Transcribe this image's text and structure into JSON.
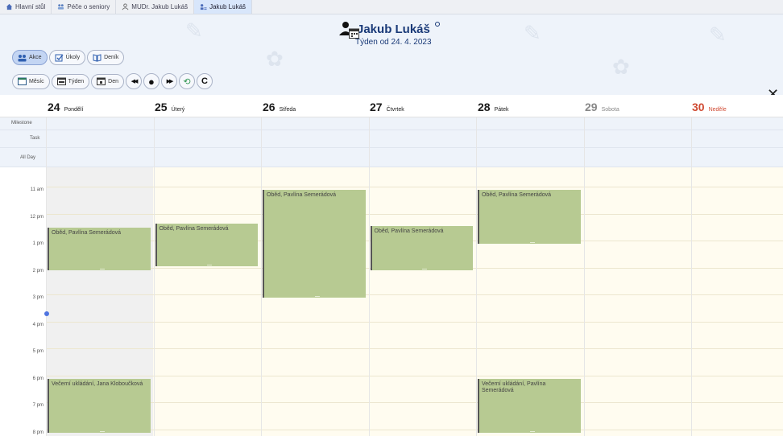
{
  "tabs": [
    {
      "label": "Hlavní stůl",
      "icon": "home-icon",
      "active": false
    },
    {
      "label": "Péče o seniory",
      "icon": "people-icon",
      "active": false
    },
    {
      "label": "MUDr. Jakub Lukáš",
      "icon": "person-icon",
      "active": false
    },
    {
      "label": "Jakub Lukáš",
      "icon": "user-list-icon",
      "active": true
    }
  ],
  "header": {
    "title": "Jakub Lukáš",
    "subtitle": "Týden od 24. 4. 2023"
  },
  "view_buttons": [
    {
      "label": "Akce",
      "icon": "people-icon",
      "active": true
    },
    {
      "label": "Úkoly",
      "icon": "checkbox-icon",
      "active": false
    },
    {
      "label": "Deník",
      "icon": "book-icon",
      "active": false
    }
  ],
  "range_buttons": [
    {
      "label": "Měsíc",
      "icon": "calendar-month-icon"
    },
    {
      "label": "Týden",
      "icon": "calendar-week-icon"
    },
    {
      "label": "Den",
      "icon": "calendar-day-icon"
    }
  ],
  "nav_buttons": [
    {
      "name": "prev-button",
      "glyph": "◀◀"
    },
    {
      "name": "today-button",
      "glyph": "●"
    },
    {
      "name": "next-button",
      "glyph": "▶▶"
    },
    {
      "name": "sync-button",
      "glyph": "⟲"
    },
    {
      "name": "refresh-button",
      "glyph": "C"
    }
  ],
  "close_glyph": "✕",
  "days": [
    {
      "num": "24",
      "name": "Pondělí",
      "color": "#1a1a1a"
    },
    {
      "num": "25",
      "name": "Úterý",
      "color": "#1a1a1a"
    },
    {
      "num": "26",
      "name": "Středa",
      "color": "#1a1a1a"
    },
    {
      "num": "27",
      "name": "Čtvrtek",
      "color": "#1a1a1a"
    },
    {
      "num": "28",
      "name": "Pátek",
      "color": "#1a1a1a"
    },
    {
      "num": "29",
      "name": "Sobota",
      "color": "#888888"
    },
    {
      "num": "30",
      "name": "Neděle",
      "color": "#d04a32"
    }
  ],
  "sections": [
    "Milestone",
    "Task",
    "All Day"
  ],
  "hours": [
    "11 am",
    "12 pm",
    "1 pm",
    "2 pm",
    "3 pm",
    "4 pm",
    "5 pm",
    "6 pm",
    "7 pm",
    "8 pm"
  ],
  "events": [
    {
      "day": 0,
      "start": 12.4,
      "end": 14.0,
      "text": "Oběd, Pavlína Semerádová"
    },
    {
      "day": 1,
      "start": 12.25,
      "end": 13.85,
      "text": "Oběd, Pavlína Semerádová"
    },
    {
      "day": 2,
      "start": 11.0,
      "end": 15.0,
      "text": "Oběd, Pavlína Semerádová"
    },
    {
      "day": 3,
      "start": 12.35,
      "end": 14.0,
      "text": "Oběd, Pavlína Semerádová"
    },
    {
      "day": 4,
      "start": 11.0,
      "end": 13.0,
      "text": "Oběd, Pavlína Semerádová"
    },
    {
      "day": 0,
      "start": 18.0,
      "end": 20.0,
      "text": "Večerní ukládání, Jana Kloboučková"
    },
    {
      "day": 4,
      "start": 18.0,
      "end": 20.0,
      "text": "Večerní ukládání, Pavlína Semerádová"
    }
  ],
  "colors": {
    "event_bg": "#b7ca92",
    "accent": "#1a3a78",
    "now_indicator": "#4f74e0"
  }
}
